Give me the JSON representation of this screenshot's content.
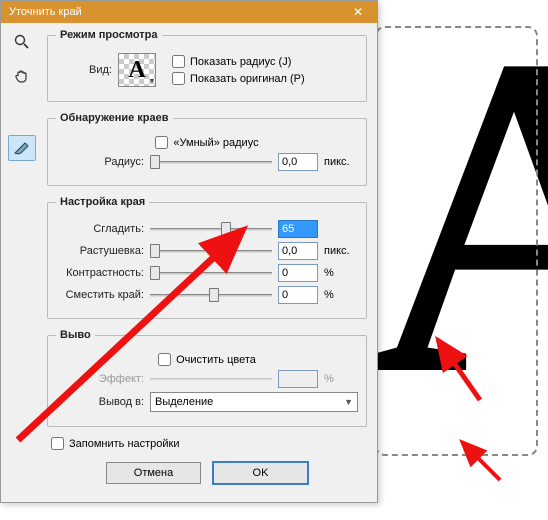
{
  "window": {
    "title": "Уточнить край"
  },
  "view_mode": {
    "legend": "Режим просмотра",
    "label": "Вид:",
    "sample": "A",
    "show_radius": "Показать радиус (J)",
    "show_original": "Показать оригинал (P)"
  },
  "edge_detect": {
    "legend": "Обнаружение краев",
    "smart": "«Умный» радиус",
    "radius_label": "Радиус:",
    "radius_value": "0,0",
    "unit": "пикс."
  },
  "edge_adjust": {
    "legend": "Настройка края",
    "smooth_label": "Сгладить:",
    "smooth_value": "65",
    "feather_label": "Растушевка:",
    "feather_value": "0,0",
    "feather_unit": "пикс.",
    "contrast_label": "Контрастность:",
    "contrast_value": "0",
    "contrast_unit": "%",
    "shift_label": "Сместить край:",
    "shift_value": "0",
    "shift_unit": "%"
  },
  "output": {
    "legend": "Выво",
    "clean_colors": "Очистить цвета",
    "effect_label": "Эффект:",
    "effect_value": "",
    "effect_unit": "%",
    "dest_label": "Вывод в:",
    "dest_value": "Выделение"
  },
  "remember": "Запомнить настройки",
  "buttons": {
    "cancel": "Отмена",
    "ok": "OK"
  },
  "bg_letter": "A"
}
